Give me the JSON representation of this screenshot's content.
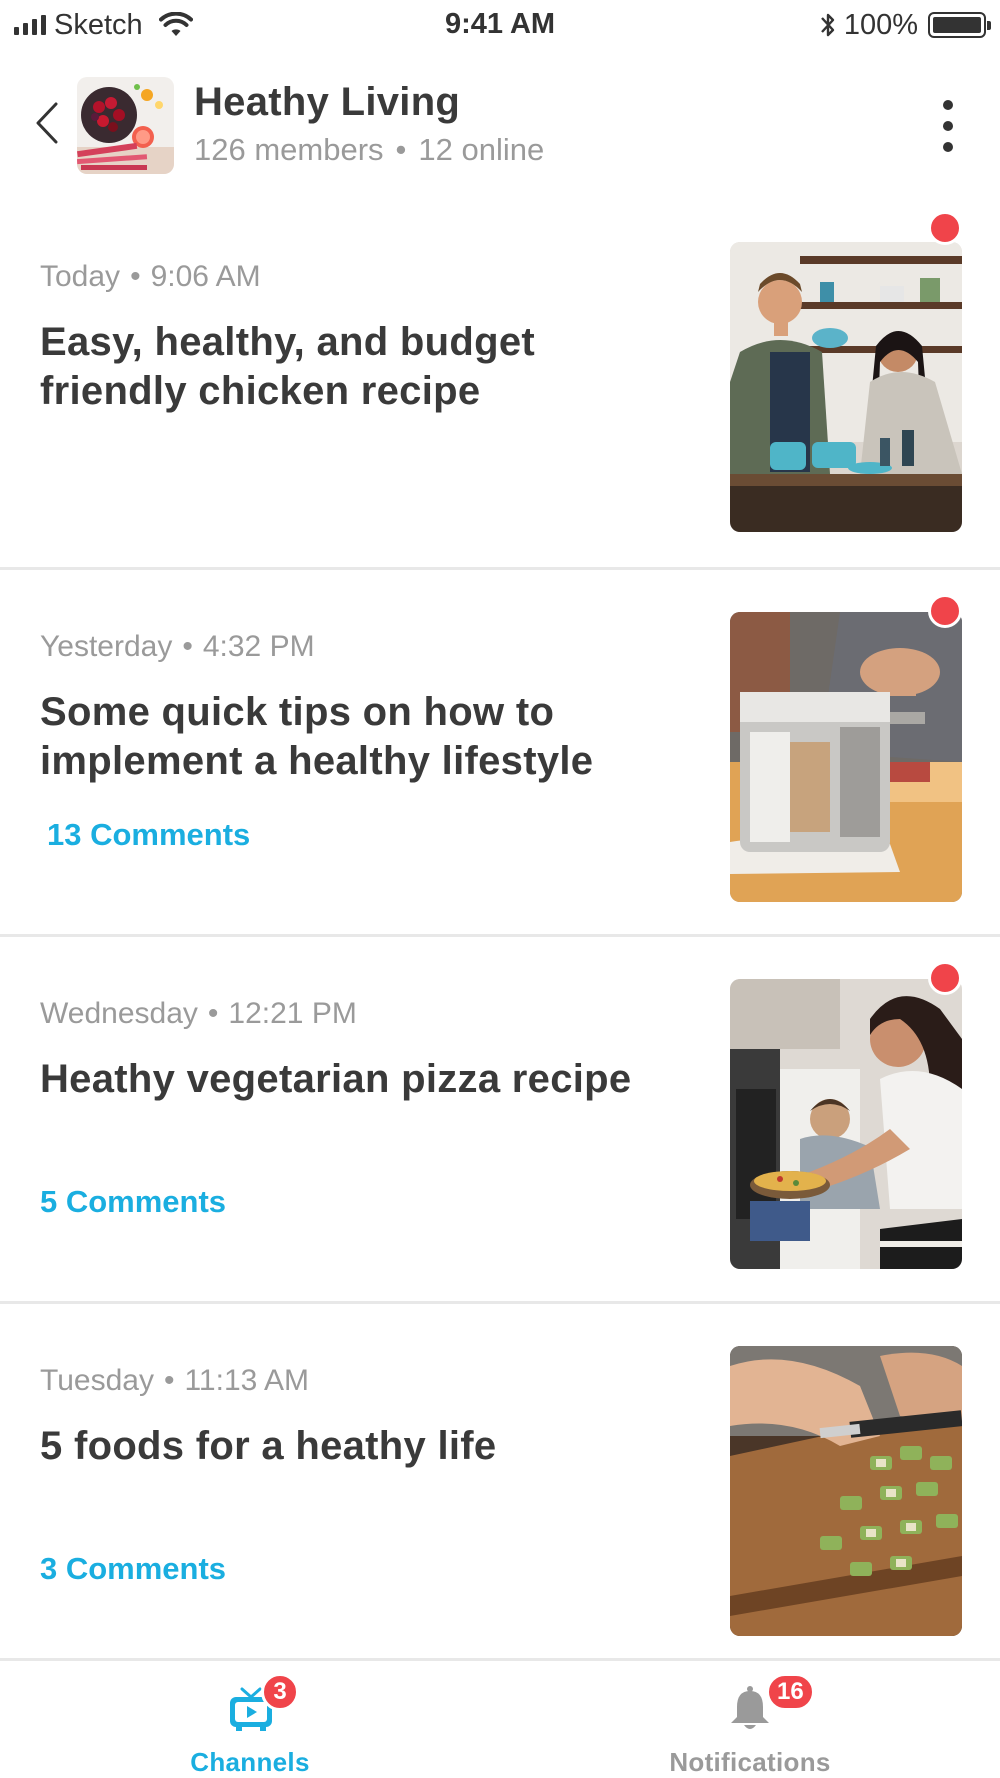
{
  "status_bar": {
    "carrier": "Sketch",
    "time": "9:41 AM",
    "battery": "100%"
  },
  "header": {
    "title": "Heathy Living",
    "members": "126 members",
    "online": "12 online",
    "separator": "•"
  },
  "posts": [
    {
      "day": "Today",
      "time": "9:06 AM",
      "title": "Easy, healthy, and budget friendly chicken recipe",
      "comments": "",
      "unread": true
    },
    {
      "day": "Yesterday",
      "time": "4:32 PM",
      "title": "Some quick tips on how to implement a healthy lifestyle",
      "comments": "13 Comments",
      "unread": true
    },
    {
      "day": "Wednesday",
      "time": "12:21 PM",
      "title": "Heathy vegetarian pizza recipe",
      "comments": "5 Comments",
      "unread": true
    },
    {
      "day": "Tuesday",
      "time": "11:13 AM",
      "title": "5 foods for a heathy life",
      "comments": "3 Comments",
      "unread": false
    }
  ],
  "tab_bar": {
    "channels": {
      "label": "Channels",
      "badge": "3",
      "icon": "tv-icon",
      "active": true
    },
    "notifications": {
      "label": "Notifications",
      "badge": "16",
      "icon": "bell-icon",
      "active": false
    }
  },
  "colors": {
    "accent": "#1aaee0",
    "badge": "#f0444a",
    "text_primary": "#3a3a3a",
    "text_secondary": "#9a9a9a",
    "divider": "#e8e8e8"
  }
}
